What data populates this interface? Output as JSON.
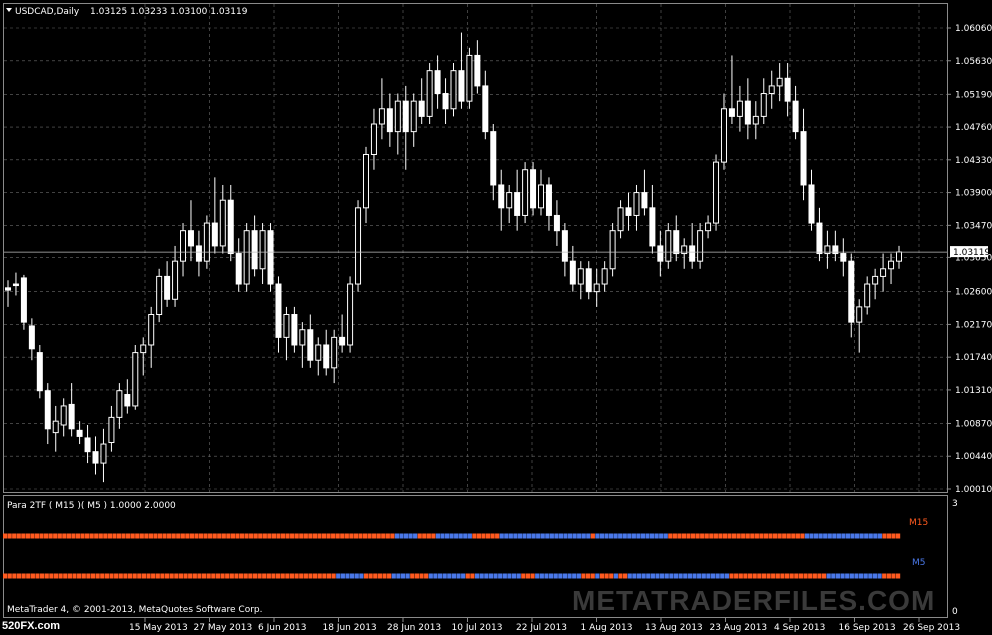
{
  "window": {
    "title": "USDCAD,Daily",
    "ohlc": "1.03125 1.03233 1.03100 1.03119"
  },
  "colors": {
    "background": "#000000",
    "grid": "#6b6b6b",
    "candle": "#ffffff",
    "m15_up": "#ff5a1f",
    "m15_down": "#4a78e8",
    "label_m15": "#ff5a1f",
    "label_m5": "#4a78e8"
  },
  "indicator": {
    "label": "Para 2TF ( M15 )( M5 ) 1.0000 2.0000",
    "row1_label": "M15",
    "row2_label": "M5",
    "scale_top": "3",
    "scale_bottom": "0",
    "copyright": "MetaTrader 4, © 2001-2013, MetaQuotes Software Corp."
  },
  "watermarks": {
    "main": "METATRADERFILES.COM",
    "corner": "520FX.com"
  },
  "chart_data": {
    "type": "candlestick",
    "symbol": "USDCAD",
    "timeframe": "Daily",
    "ylim": [
      1.0001,
      1.0606
    ],
    "current_price": "1.03119",
    "price_ticks": [
      "1.06060",
      "1.05630",
      "1.05190",
      "1.04760",
      "1.04330",
      "1.03900",
      "1.03470",
      "1.03050",
      "1.02600",
      "1.02170",
      "1.01740",
      "1.01310",
      "1.00870",
      "1.00440",
      "1.00010"
    ],
    "date_ticks": [
      "15 May 2013",
      "27 May 2013",
      "6 Jun 2013",
      "18 Jun 2013",
      "28 Jun 2013",
      "10 Jul 2013",
      "22 Jul 2013",
      "1 Aug 2013",
      "13 Aug 2013",
      "23 Aug 2013",
      "4 Sep 2013",
      "16 Sep 2013",
      "26 Sep 2013"
    ],
    "candles": [
      [
        1.0265,
        1.0275,
        1.024,
        1.0262
      ],
      [
        1.027,
        1.0285,
        1.0255,
        1.0268
      ],
      [
        1.0278,
        1.0282,
        1.021,
        1.022
      ],
      [
        1.0215,
        1.0225,
        1.017,
        1.0185
      ],
      [
        1.018,
        1.019,
        1.012,
        1.013
      ],
      [
        1.013,
        1.014,
        1.006,
        1.008
      ],
      [
        1.0075,
        1.011,
        1.005,
        1.009
      ],
      [
        1.0085,
        1.012,
        1.007,
        1.011
      ],
      [
        1.0112,
        1.014,
        1.007,
        1.008
      ],
      [
        1.0078,
        1.009,
        1.006,
        1.007
      ],
      [
        1.0068,
        1.0085,
        1.0035,
        1.005
      ],
      [
        1.005,
        1.007,
        1.002,
        1.0035
      ],
      [
        1.0035,
        1.008,
        1.001,
        1.006
      ],
      [
        1.0062,
        1.011,
        1.005,
        1.0095
      ],
      [
        1.0095,
        1.014,
        1.008,
        1.013
      ],
      [
        1.0125,
        1.0145,
        1.01,
        1.011
      ],
      [
        1.011,
        1.019,
        1.0105,
        1.018
      ],
      [
        1.018,
        1.02,
        1.015,
        1.019
      ],
      [
        1.019,
        1.024,
        1.016,
        1.023
      ],
      [
        1.023,
        1.029,
        1.022,
        1.028
      ],
      [
        1.028,
        1.03,
        1.024,
        1.025
      ],
      [
        1.025,
        1.032,
        1.024,
        1.03
      ],
      [
        1.03,
        1.035,
        1.028,
        1.034
      ],
      [
        1.034,
        1.038,
        1.03,
        1.032
      ],
      [
        1.032,
        1.034,
        1.028,
        1.03
      ],
      [
        1.03,
        1.036,
        1.029,
        1.035
      ],
      [
        1.035,
        1.041,
        1.031,
        1.032
      ],
      [
        1.032,
        1.04,
        1.031,
        1.038
      ],
      [
        1.038,
        1.04,
        1.03,
        1.031
      ],
      [
        1.031,
        1.033,
        1.026,
        1.027
      ],
      [
        1.027,
        1.035,
        1.026,
        1.034
      ],
      [
        1.034,
        1.036,
        1.028,
        1.029
      ],
      [
        1.029,
        1.035,
        1.027,
        1.034
      ],
      [
        1.034,
        1.035,
        1.026,
        1.027
      ],
      [
        1.027,
        1.028,
        1.018,
        1.02
      ],
      [
        1.02,
        1.024,
        1.017,
        1.023
      ],
      [
        1.023,
        1.024,
        1.018,
        1.019
      ],
      [
        1.019,
        1.022,
        1.016,
        1.021
      ],
      [
        1.021,
        1.023,
        1.016,
        1.017
      ],
      [
        1.017,
        1.02,
        1.015,
        1.019
      ],
      [
        1.019,
        1.021,
        1.015,
        1.016
      ],
      [
        1.016,
        1.021,
        1.014,
        1.02
      ],
      [
        1.02,
        1.023,
        1.018,
        1.019
      ],
      [
        1.019,
        1.028,
        1.018,
        1.027
      ],
      [
        1.027,
        1.038,
        1.026,
        1.037
      ],
      [
        1.037,
        1.045,
        1.035,
        1.044
      ],
      [
        1.044,
        1.05,
        1.042,
        1.048
      ],
      [
        1.048,
        1.054,
        1.046,
        1.05
      ],
      [
        1.05,
        1.052,
        1.045,
        1.047
      ],
      [
        1.047,
        1.052,
        1.044,
        1.051
      ],
      [
        1.051,
        1.053,
        1.042,
        1.047
      ],
      [
        1.047,
        1.052,
        1.045,
        1.051
      ],
      [
        1.051,
        1.054,
        1.048,
        1.049
      ],
      [
        1.049,
        1.056,
        1.048,
        1.055
      ],
      [
        1.055,
        1.057,
        1.05,
        1.052
      ],
      [
        1.052,
        1.054,
        1.048,
        1.05
      ],
      [
        1.05,
        1.056,
        1.049,
        1.055
      ],
      [
        1.055,
        1.06,
        1.05,
        1.051
      ],
      [
        1.051,
        1.058,
        1.05,
        1.057
      ],
      [
        1.057,
        1.059,
        1.052,
        1.053
      ],
      [
        1.053,
        1.055,
        1.046,
        1.047
      ],
      [
        1.047,
        1.048,
        1.038,
        1.04
      ],
      [
        1.04,
        1.042,
        1.034,
        1.037
      ],
      [
        1.037,
        1.04,
        1.035,
        1.039
      ],
      [
        1.039,
        1.042,
        1.034,
        1.036
      ],
      [
        1.036,
        1.043,
        1.035,
        1.042
      ],
      [
        1.042,
        1.043,
        1.036,
        1.037
      ],
      [
        1.037,
        1.042,
        1.036,
        1.04
      ],
      [
        1.04,
        1.041,
        1.034,
        1.036
      ],
      [
        1.036,
        1.038,
        1.032,
        1.034
      ],
      [
        1.034,
        1.035,
        1.028,
        1.03
      ],
      [
        1.03,
        1.032,
        1.026,
        1.027
      ],
      [
        1.027,
        1.03,
        1.025,
        1.029
      ],
      [
        1.029,
        1.03,
        1.025,
        1.026
      ],
      [
        1.026,
        1.029,
        1.024,
        1.027
      ],
      [
        1.027,
        1.03,
        1.026,
        1.029
      ],
      [
        1.029,
        1.035,
        1.028,
        1.034
      ],
      [
        1.034,
        1.038,
        1.033,
        1.037
      ],
      [
        1.037,
        1.039,
        1.034,
        1.036
      ],
      [
        1.036,
        1.04,
        1.034,
        1.039
      ],
      [
        1.039,
        1.042,
        1.036,
        1.037
      ],
      [
        1.037,
        1.04,
        1.031,
        1.032
      ],
      [
        1.032,
        1.034,
        1.028,
        1.03
      ],
      [
        1.03,
        1.035,
        1.029,
        1.034
      ],
      [
        1.034,
        1.036,
        1.03,
        1.031
      ],
      [
        1.031,
        1.033,
        1.029,
        1.032
      ],
      [
        1.032,
        1.035,
        1.029,
        1.03
      ],
      [
        1.03,
        1.035,
        1.029,
        1.034
      ],
      [
        1.034,
        1.036,
        1.033,
        1.035
      ],
      [
        1.035,
        1.044,
        1.034,
        1.043
      ],
      [
        1.043,
        1.052,
        1.042,
        1.05
      ],
      [
        1.05,
        1.057,
        1.048,
        1.049
      ],
      [
        1.049,
        1.053,
        1.047,
        1.051
      ],
      [
        1.051,
        1.054,
        1.046,
        1.048
      ],
      [
        1.048,
        1.051,
        1.046,
        1.049
      ],
      [
        1.049,
        1.054,
        1.048,
        1.052
      ],
      [
        1.052,
        1.055,
        1.05,
        1.053
      ],
      [
        1.053,
        1.056,
        1.051,
        1.054
      ],
      [
        1.054,
        1.056,
        1.049,
        1.051
      ],
      [
        1.051,
        1.053,
        1.046,
        1.047
      ],
      [
        1.047,
        1.05,
        1.038,
        1.04
      ],
      [
        1.04,
        1.042,
        1.034,
        1.035
      ],
      [
        1.035,
        1.037,
        1.03,
        1.031
      ],
      [
        1.031,
        1.034,
        1.029,
        1.032
      ],
      [
        1.032,
        1.034,
        1.03,
        1.031
      ],
      [
        1.031,
        1.033,
        1.028,
        1.03
      ],
      [
        1.03,
        1.031,
        1.02,
        1.022
      ],
      [
        1.022,
        1.025,
        1.018,
        1.024
      ],
      [
        1.024,
        1.028,
        1.023,
        1.027
      ],
      [
        1.027,
        1.029,
        1.025,
        1.028
      ],
      [
        1.028,
        1.031,
        1.026,
        1.029
      ],
      [
        1.029,
        1.031,
        1.027,
        1.03
      ],
      [
        1.03,
        1.032,
        1.029,
        1.0312
      ]
    ],
    "m15_colors": "oooooooooooooooooooooooooooooooooooooooooooooooooooooooooooooooooooooooooooooooooooooobbbbboooobbbbbbbboooooobbbbbbbbbbbbbbbbbbbbobbbbbbbbbbbbbbbboooooooooooooooooooooooooooooobbbbbbbbbbbbbbbbboooo",
    "m5_colors": "oooooooooooooooooooooooooooooooooooooooooooooooooooooooooooooooooooooooobbbbbboooooobbbboooobbbbbbbboobbbbbbbbbbooobbbbbbbbbboooboooboobbbbbbbbbbbbbbbbbbbbbbooooooooooooooooooooobbbbbbbbbbbboooo"
  }
}
